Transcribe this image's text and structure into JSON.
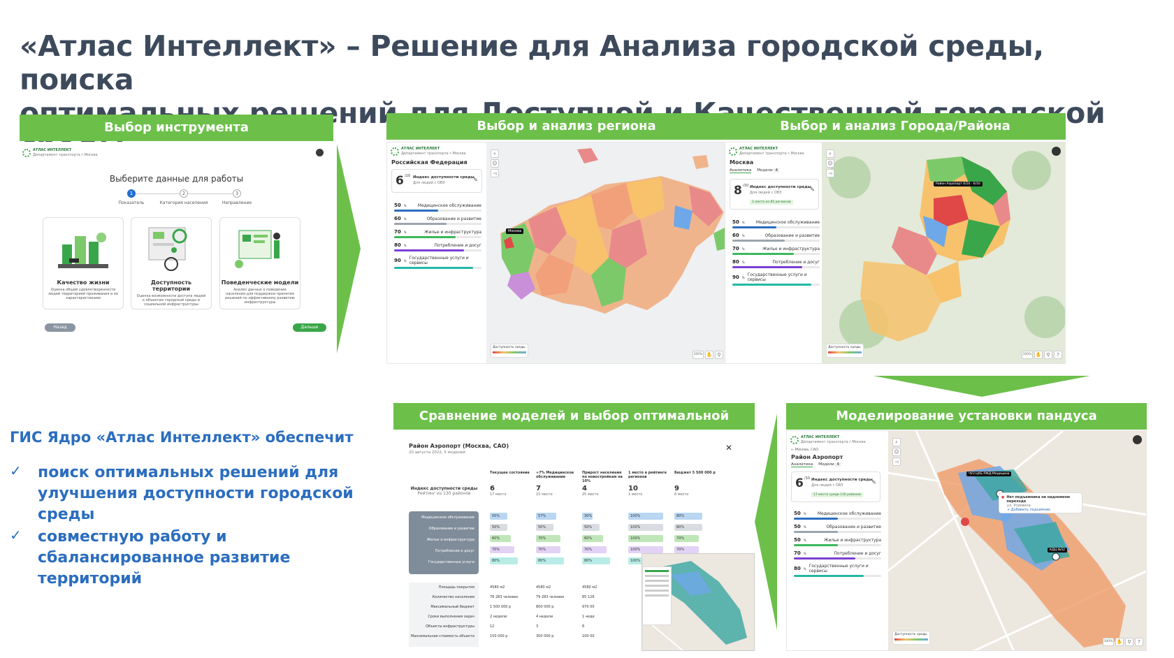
{
  "title_line1": "«Атлас Интеллект» – Решение для Анализа городской среды, поиска",
  "title_line2": "оптимальных решений для Доступной и Качественной городской среды",
  "sections": {
    "s1": "Выбор инструмента",
    "s2": "Выбор и анализ региона",
    "s3": "Выбор и анализ Города/Района",
    "s4": "Сравнение моделей и выбор оптимальной",
    "s5": "Моделирование установки пандуса"
  },
  "logo": {
    "name": "АТЛАС ИНТЕЛЛЕКТ",
    "sub": "Департамент транспорта г.Москва"
  },
  "tool": {
    "heading": "Выберите данные для работы",
    "steps": [
      {
        "n": "1",
        "label": "Показатель"
      },
      {
        "n": "2",
        "label": "Категория населения"
      },
      {
        "n": "3",
        "label": "Направление"
      }
    ],
    "cards": [
      {
        "name": "Качество жизни",
        "desc": "Оценка общей удовлетворенности людей территорией проживания и ее характеристиками"
      },
      {
        "name": "Доступность территории",
        "desc": "Оценка возможности доступа людей к объектам городской среды и социальной инфраструктуры"
      },
      {
        "name": "Поведенческие модели",
        "desc": "Анализ данных о поведении населения для поддержки принятия решений по эффективному развитию инфраструктуры"
      }
    ],
    "back": "Назад",
    "next": "Дальше"
  },
  "region": {
    "name": "Российская Федерация",
    "index_value": "6",
    "index_max": "/10",
    "index_label": "Индекс доступности среды",
    "index_sub": "Для людей с ОВЗ",
    "rows": [
      {
        "pct": "50",
        "label": "Медицинское обслуживание",
        "color": "#2b6dbf",
        "fill": 0.5
      },
      {
        "pct": "60",
        "label": "Образование и развитие",
        "color": "#9aa5b1",
        "fill": 0.6
      },
      {
        "pct": "70",
        "label": "Жилье и инфраструктура",
        "color": "#3cb85c",
        "fill": 0.7
      },
      {
        "pct": "80",
        "label": "Потребление и досуг",
        "color": "#7a3fd1",
        "fill": 0.8
      },
      {
        "pct": "90",
        "label": "Государственные услуги и сервисы",
        "color": "#22b8a8",
        "fill": 0.9
      }
    ],
    "map_label": "Москва",
    "legend": "Доступность среды",
    "zoom": "100%"
  },
  "city": {
    "name": "Москва",
    "tabs": [
      "Аналитика",
      "Модели"
    ],
    "models_count": "4",
    "index_value": "8",
    "index_max": "/10",
    "index_label": "Индекс доступности среды",
    "index_sub": "Для людей с ОВЗ",
    "rank": "1 место из 85 регионов",
    "rows": [
      {
        "pct": "50",
        "label": "Медицинское обслуживание",
        "color": "#2b6dbf",
        "fill": 0.5
      },
      {
        "pct": "60",
        "label": "Образование и развитие",
        "color": "#9aa5b1",
        "fill": 0.6
      },
      {
        "pct": "70",
        "label": "Жилье и инфраструктура",
        "color": "#3cb85c",
        "fill": 0.7
      },
      {
        "pct": "80",
        "label": "Потребление и досуг",
        "color": "#7a3fd1",
        "fill": 0.8
      },
      {
        "pct": "90",
        "label": "Государственные услуги и сервисы",
        "color": "#22b8a8",
        "fill": 0.9
      }
    ],
    "tooltip": "Район Аэропорт 6/10 · 6/10",
    "legend": "Доступность среды",
    "zoom": "100%"
  },
  "compare": {
    "title": "Район Аэропорт (Москва, САО)",
    "sub": "20 августа 2022, 5 моделей",
    "columns": [
      "Текущее состояние",
      "+7% Медицинское обслуживание",
      "Прирост населения по новостройкам на 10%",
      "1 место в рейтинге регионов",
      "Бюджет 5 500 000 р"
    ],
    "index_label": "Индекс доступности среды",
    "index_sub": "Рейтинг из 130 районов",
    "index_values": [
      "6",
      "7",
      "4",
      "10",
      "9"
    ],
    "index_places": [
      "17 место",
      "15 место",
      "25 место",
      "1 место",
      "6 место"
    ],
    "categories": [
      "Медицинское обслуживание",
      "Образование и развитие",
      "Жилье и инфраструктура",
      "Потребление и досуг",
      "Государственные услуги"
    ],
    "cat_values": [
      [
        "50%",
        "57%",
        "30%",
        "100%",
        "80%"
      ],
      [
        "50%",
        "50%",
        "50%",
        "100%",
        "80%"
      ],
      [
        "60%",
        "70%",
        "60%",
        "100%",
        "70%"
      ],
      [
        "70%",
        "70%",
        "70%",
        "100%",
        "70%"
      ],
      [
        "80%",
        "80%",
        "80%",
        "100%",
        "80%"
      ]
    ],
    "params": [
      "Площадь покрытия",
      "Количество населения",
      "Максимальный бюджет",
      "Сроки выполнения задач",
      "Объекты инфраструктуры",
      "Максимальная стоимость объекта"
    ],
    "param_values": [
      [
        "4580 м2",
        "4580 м2",
        "4580 м2"
      ],
      [
        "78 283 человек",
        "79 283 человек",
        "85 126"
      ],
      [
        "1 500 000 р",
        "800 000 р",
        "970 00"
      ],
      [
        "2 недели",
        "4 недели",
        "1 неде"
      ],
      [
        "12",
        "3",
        "8"
      ],
      [
        "150 000 р",
        "300 000 р",
        "100 00"
      ]
    ]
  },
  "ramp": {
    "breadcrumb": "Москва, САО",
    "name": "Район Аэропорт",
    "tabs": [
      "Аналитика",
      "Модели"
    ],
    "models_count": "4",
    "index_value": "6",
    "index_max": "/10",
    "index_label": "Индекс доступности среды",
    "index_sub": "Для людей с ОВЗ",
    "rank": "17 место среди 130 районов",
    "rows": [
      {
        "pct": "50",
        "label": "Медицинское обслуживание",
        "color": "#2b6dbf",
        "fill": 0.5
      },
      {
        "pct": "50",
        "label": "Образование и развитие",
        "color": "#9aa5b1",
        "fill": 0.5
      },
      {
        "pct": "50",
        "label": "Жилье и инфраструктура",
        "color": "#3cb85c",
        "fill": 0.5
      },
      {
        "pct": "70",
        "label": "Потребление и досуг",
        "color": "#7a3fd1",
        "fill": 0.7
      },
      {
        "pct": "80",
        "label": "Государственные услуги и сервисы",
        "color": "#22b8a8",
        "fill": 0.8
      }
    ],
    "popup_title": "Нет подъемника на надземном переходе",
    "popup_addr": "ул. Усиевича",
    "popup_action": "Добавить подъемник",
    "marker1": "ЧУЗ ЦКБ РЖД-Медицина",
    "marker2": "КДЦ №52",
    "legend": "Доступность среды",
    "zoom": "100%"
  },
  "gis": {
    "heading": "ГИС Ядро «Атлас Интеллект» обеспечит",
    "items": [
      "поиск оптимальных решений для улучшения доступности городской среды",
      "совместную работу и сбалансированное развитие территорий"
    ]
  }
}
